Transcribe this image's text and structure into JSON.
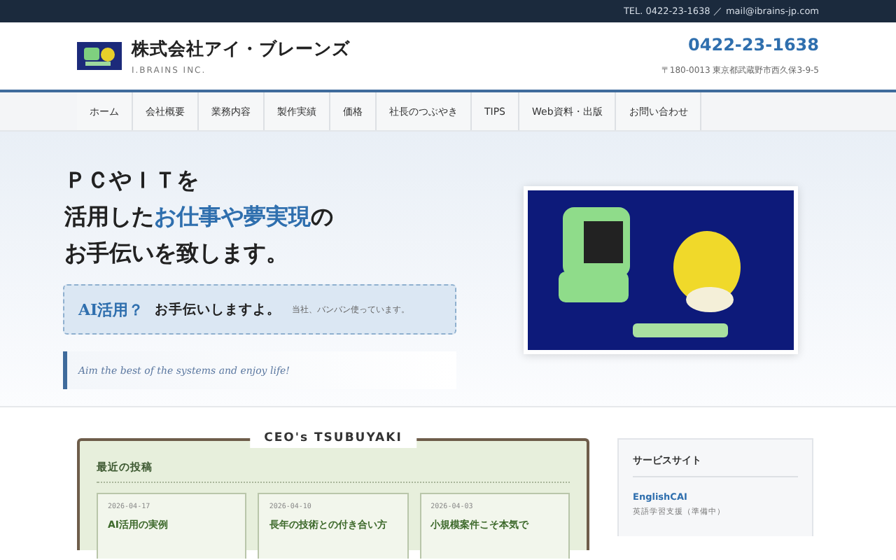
{
  "top_bar": {
    "contact": "TEL. 0422-23-1638 ／ mail@ibrains-jp.com"
  },
  "header": {
    "company_name": "株式会社アイ・ブレーンズ",
    "company_name_en": "I.BRAINS INC.",
    "phone": "0422-23-1638",
    "address": "〒180-0013 東京都武蔵野市西久保3-9-5"
  },
  "nav": [
    {
      "label": "ホーム"
    },
    {
      "label": "会社概要"
    },
    {
      "label": "業務内容"
    },
    {
      "label": "製作実績"
    },
    {
      "label": "価格"
    },
    {
      "label": "社長のつぶやき"
    },
    {
      "label": "TIPS"
    },
    {
      "label": "Web資料・出版"
    },
    {
      "label": "お問い合わせ"
    }
  ],
  "hero": {
    "headline": [
      [
        {
          "text": "ＰＣやＩＴを",
          "accent": false
        }
      ],
      [
        {
          "text": "活用した",
          "accent": false
        },
        {
          "text": "お仕事や夢実現",
          "accent": true
        },
        {
          "text": "の",
          "accent": false
        }
      ],
      [
        {
          "text": "お手伝いを致します。",
          "accent": false
        }
      ]
    ],
    "ai_box": {
      "lead": "AI活用？",
      "text": "お手伝いしますよ。",
      "note": "当社、バンバン使っています。"
    },
    "tagline": "Aim the best of the systems and enjoy life!"
  },
  "blog": {
    "title": "CEO's TSUBUYAKI",
    "heading": "最近の投稿",
    "posts": [
      {
        "date": "2026-04-17",
        "title": "AI活用の実例"
      },
      {
        "date": "2026-04-10",
        "title": "長年の技術との付き合い方"
      },
      {
        "date": "2026-04-03",
        "title": "小規模案件こそ本気で"
      }
    ]
  },
  "sidebar": {
    "heading": "サービスサイト",
    "links": [
      {
        "title": "EnglishCAI",
        "description": "英語学習支援（準備中）"
      }
    ]
  }
}
